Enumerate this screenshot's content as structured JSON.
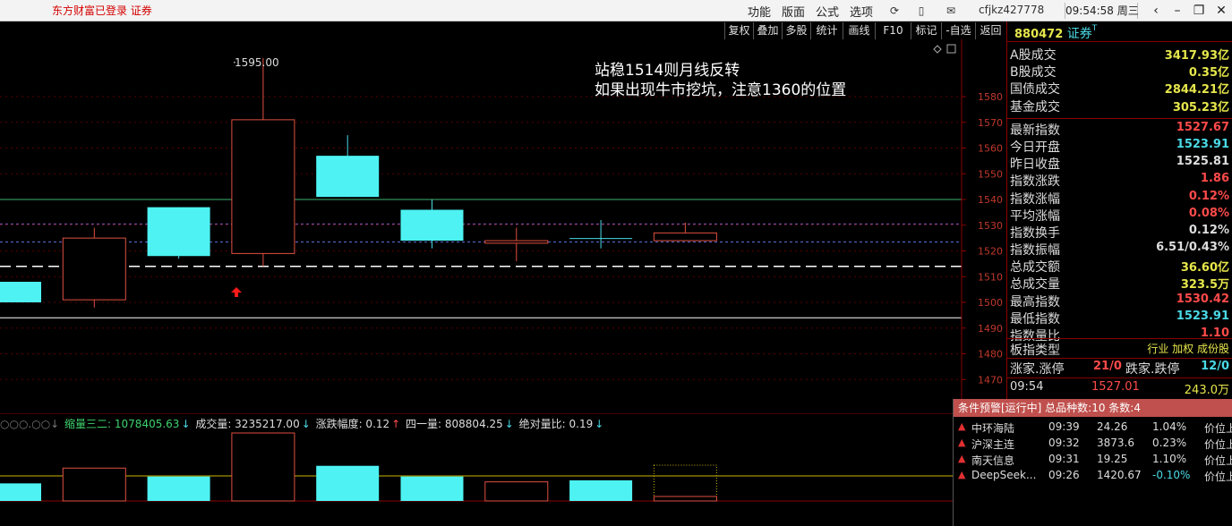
{
  "topbar": {
    "login_status": "东方财富已登录  证券",
    "menu": [
      "功能",
      "版面",
      "公式",
      "选项"
    ],
    "account": "cfjkz427778",
    "clock": "09:54:58 周三"
  },
  "toolbar": [
    "复权",
    "叠加",
    "多股",
    "统计",
    "画线",
    "F10",
    "标记",
    "-自选",
    "返回"
  ],
  "annotation": {
    "line1": "站稳1514则月线反转",
    "line2": "如果出现牛市挖坑，注意1360的位置"
  },
  "chart_data": {
    "type": "candlestick",
    "y_ticks": [
      "1580",
      "1570",
      "1560",
      "1550",
      "1540",
      "1530",
      "1520",
      "1510",
      "1500",
      "1490",
      "1480",
      "1470"
    ],
    "high_label": "1595.00",
    "candles": [
      {
        "o": 1500,
        "c": 1508,
        "h": 1508,
        "l": 1500,
        "dir": "down"
      },
      {
        "o": 1501,
        "c": 1525,
        "h": 1529,
        "l": 1498,
        "dir": "up"
      },
      {
        "o": 1537,
        "c": 1518,
        "h": 1537,
        "l": 1517,
        "dir": "down"
      },
      {
        "o": 1519,
        "c": 1571,
        "h": 1595,
        "l": 1514,
        "dir": "up"
      },
      {
        "o": 1557,
        "c": 1541,
        "h": 1565,
        "l": 1541,
        "dir": "down"
      },
      {
        "o": 1536,
        "c": 1524,
        "h": 1540,
        "l": 1521,
        "dir": "down"
      },
      {
        "o": 1523,
        "c": 1524,
        "h": 1529,
        "l": 1516,
        "dir": "up"
      },
      {
        "o": 1525,
        "c": 1525,
        "h": 1532,
        "l": 1521,
        "dir": "flat"
      },
      {
        "o": 1524,
        "c": 1527,
        "h": 1531,
        "l": 1524,
        "dir": "up"
      }
    ],
    "lines": [
      {
        "value": 1540,
        "color": "#3cb371",
        "style": "solid"
      },
      {
        "value": 1530.5,
        "color": "#8a5cc0",
        "style": "dash"
      },
      {
        "value": 1523.5,
        "color": "#5b6fd8",
        "style": "dash"
      },
      {
        "value": 1514,
        "color": "#ffffff",
        "style": "longdash"
      },
      {
        "value": 1494,
        "color": "#ffffff",
        "style": "solid"
      }
    ],
    "volume": [
      {
        "v": 2300000,
        "dir": "down"
      },
      {
        "v": 4300000,
        "dir": "up"
      },
      {
        "v": 3200000,
        "dir": "down"
      },
      {
        "v": 8900000,
        "dir": "up"
      },
      {
        "v": 4600000,
        "dir": "down"
      },
      {
        "v": 3200000,
        "dir": "down"
      },
      {
        "v": 2500000,
        "dir": "up"
      },
      {
        "v": 2700000,
        "dir": "down"
      },
      {
        "v": 3235217,
        "dir": "up-current"
      }
    ]
  },
  "volume_legend": {
    "prefix": "缩量三二: 1078405.63",
    "vol": "成交量: 3235217.00",
    "chg": "涨跌幅度: 0.12",
    "s2": "四一量: 808804.25",
    "ratio": "绝对量比: 0.19"
  },
  "panel": {
    "code": "880472",
    "name": "证券",
    "rows": [
      {
        "label": "A股成交",
        "value": "3417.93亿",
        "color": "#e6e64c"
      },
      {
        "label": "B股成交",
        "value": "0.35亿",
        "color": "#e6e64c"
      },
      {
        "label": "国债成交",
        "value": "2844.21亿",
        "color": "#e6e64c"
      },
      {
        "label": "基金成交",
        "value": "305.23亿",
        "color": "#e6e64c"
      },
      {
        "label": "最新指数",
        "value": "1527.67",
        "color": "#ff4a4a"
      },
      {
        "label": "今日开盘",
        "value": "1523.91",
        "color": "#4ad9e6"
      },
      {
        "label": "昨日收盘",
        "value": "1525.81",
        "color": "#dddddd"
      },
      {
        "label": "指数涨跌",
        "value": "1.86",
        "color": "#ff4a4a"
      },
      {
        "label": "指数涨幅",
        "value": "0.12%",
        "color": "#ff4a4a"
      },
      {
        "label": "平均涨幅",
        "value": "0.08%",
        "color": "#ff4a4a"
      },
      {
        "label": "指数换手",
        "value": "0.12%",
        "color": "#dddddd"
      },
      {
        "label": "指数振幅",
        "value": "6.51/0.43%",
        "color": "#dddddd"
      },
      {
        "label": "总成交额",
        "value": "36.60亿",
        "color": "#e6e64c"
      },
      {
        "label": "总成交量",
        "value": "323.5万",
        "color": "#e6e64c"
      },
      {
        "label": "最高指数",
        "value": "1530.42",
        "color": "#ff4a4a"
      },
      {
        "label": "最低指数",
        "value": "1523.91",
        "color": "#4ad9e6"
      },
      {
        "label": "指数量比",
        "value": "1.10",
        "color": "#ff4a4a"
      }
    ],
    "type_label": "板指类型",
    "type_value": "行业 加权 成份股",
    "up_label": "涨家.涨停",
    "up_value": "21/0",
    "down_label": "跌家.跌停",
    "down_value": "12/0",
    "tick_time": "09:54",
    "tick_price": "1527.01",
    "tick_vol": "243.0万"
  },
  "alerts": {
    "header": "条件预警[运行中] 总品种数:10 条数:4",
    "rows": [
      {
        "name": "中环海陆",
        "time": "09:39",
        "price": "24.26",
        "pct": "1.04%",
        "note": "价位上"
      },
      {
        "name": "沪深主连",
        "time": "09:32",
        "price": "3873.6",
        "pct": "0.23%",
        "note": "价位上"
      },
      {
        "name": "南天信息",
        "time": "09:31",
        "price": "19.25",
        "pct": "1.10%",
        "note": "价位上"
      },
      {
        "name": "DeepSeek...",
        "time": "09:26",
        "price": "1420.67",
        "pct": "-0.10%",
        "note": "价位上"
      }
    ]
  }
}
